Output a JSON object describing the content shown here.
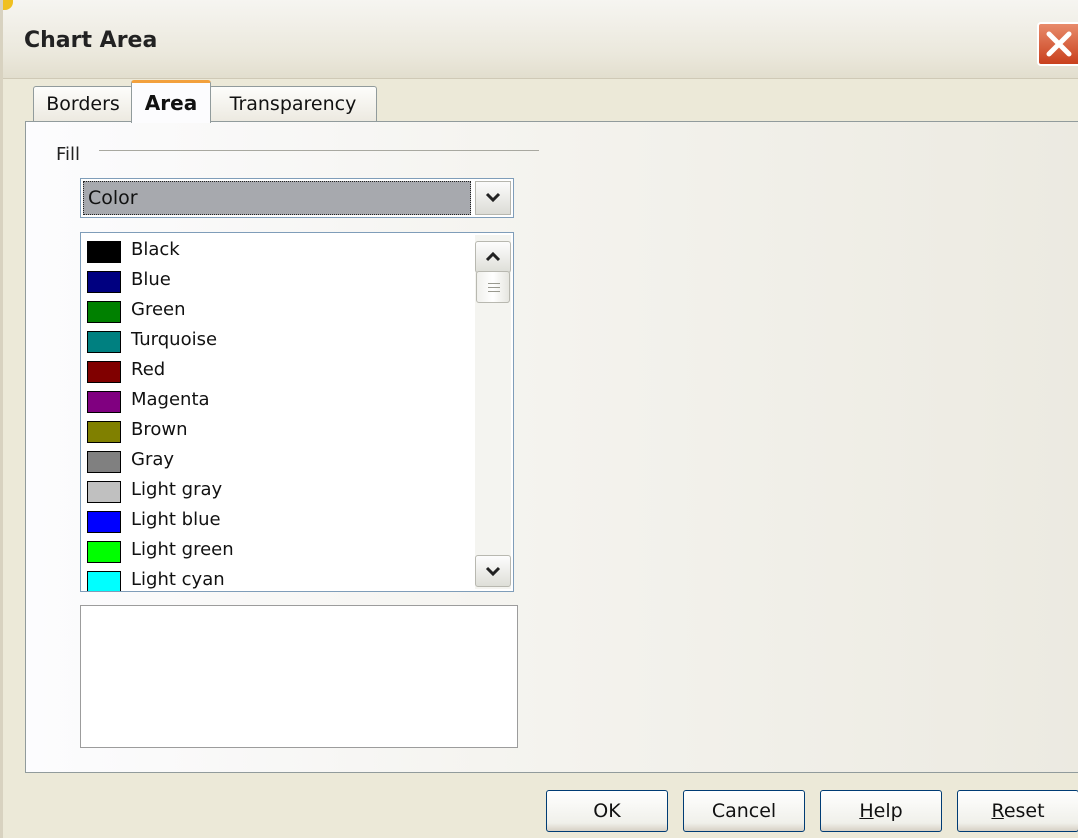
{
  "dialog": {
    "title": "Chart Area"
  },
  "tabs": [
    {
      "label": "Borders",
      "active": false
    },
    {
      "label": "Area",
      "active": true
    },
    {
      "label": "Transparency",
      "active": false
    }
  ],
  "fill": {
    "group_label": "Fill",
    "type_selected": "Color"
  },
  "colors": [
    {
      "label": "Black",
      "color": "#000000"
    },
    {
      "label": "Blue",
      "color": "#000080"
    },
    {
      "label": "Green",
      "color": "#008000"
    },
    {
      "label": "Turquoise",
      "color": "#008080"
    },
    {
      "label": "Red",
      "color": "#800000"
    },
    {
      "label": "Magenta",
      "color": "#800080"
    },
    {
      "label": "Brown",
      "color": "#808000"
    },
    {
      "label": "Gray",
      "color": "#808080"
    },
    {
      "label": "Light gray",
      "color": "#c0c0c0"
    },
    {
      "label": "Light blue",
      "color": "#0000ff"
    },
    {
      "label": "Light green",
      "color": "#00ff00"
    },
    {
      "label": "Light cyan",
      "color": "#00ffff"
    }
  ],
  "buttons": {
    "ok": "OK",
    "cancel": "Cancel",
    "help_first": "H",
    "help_rest": "elp",
    "reset_first": "R",
    "reset_rest": "eset"
  }
}
